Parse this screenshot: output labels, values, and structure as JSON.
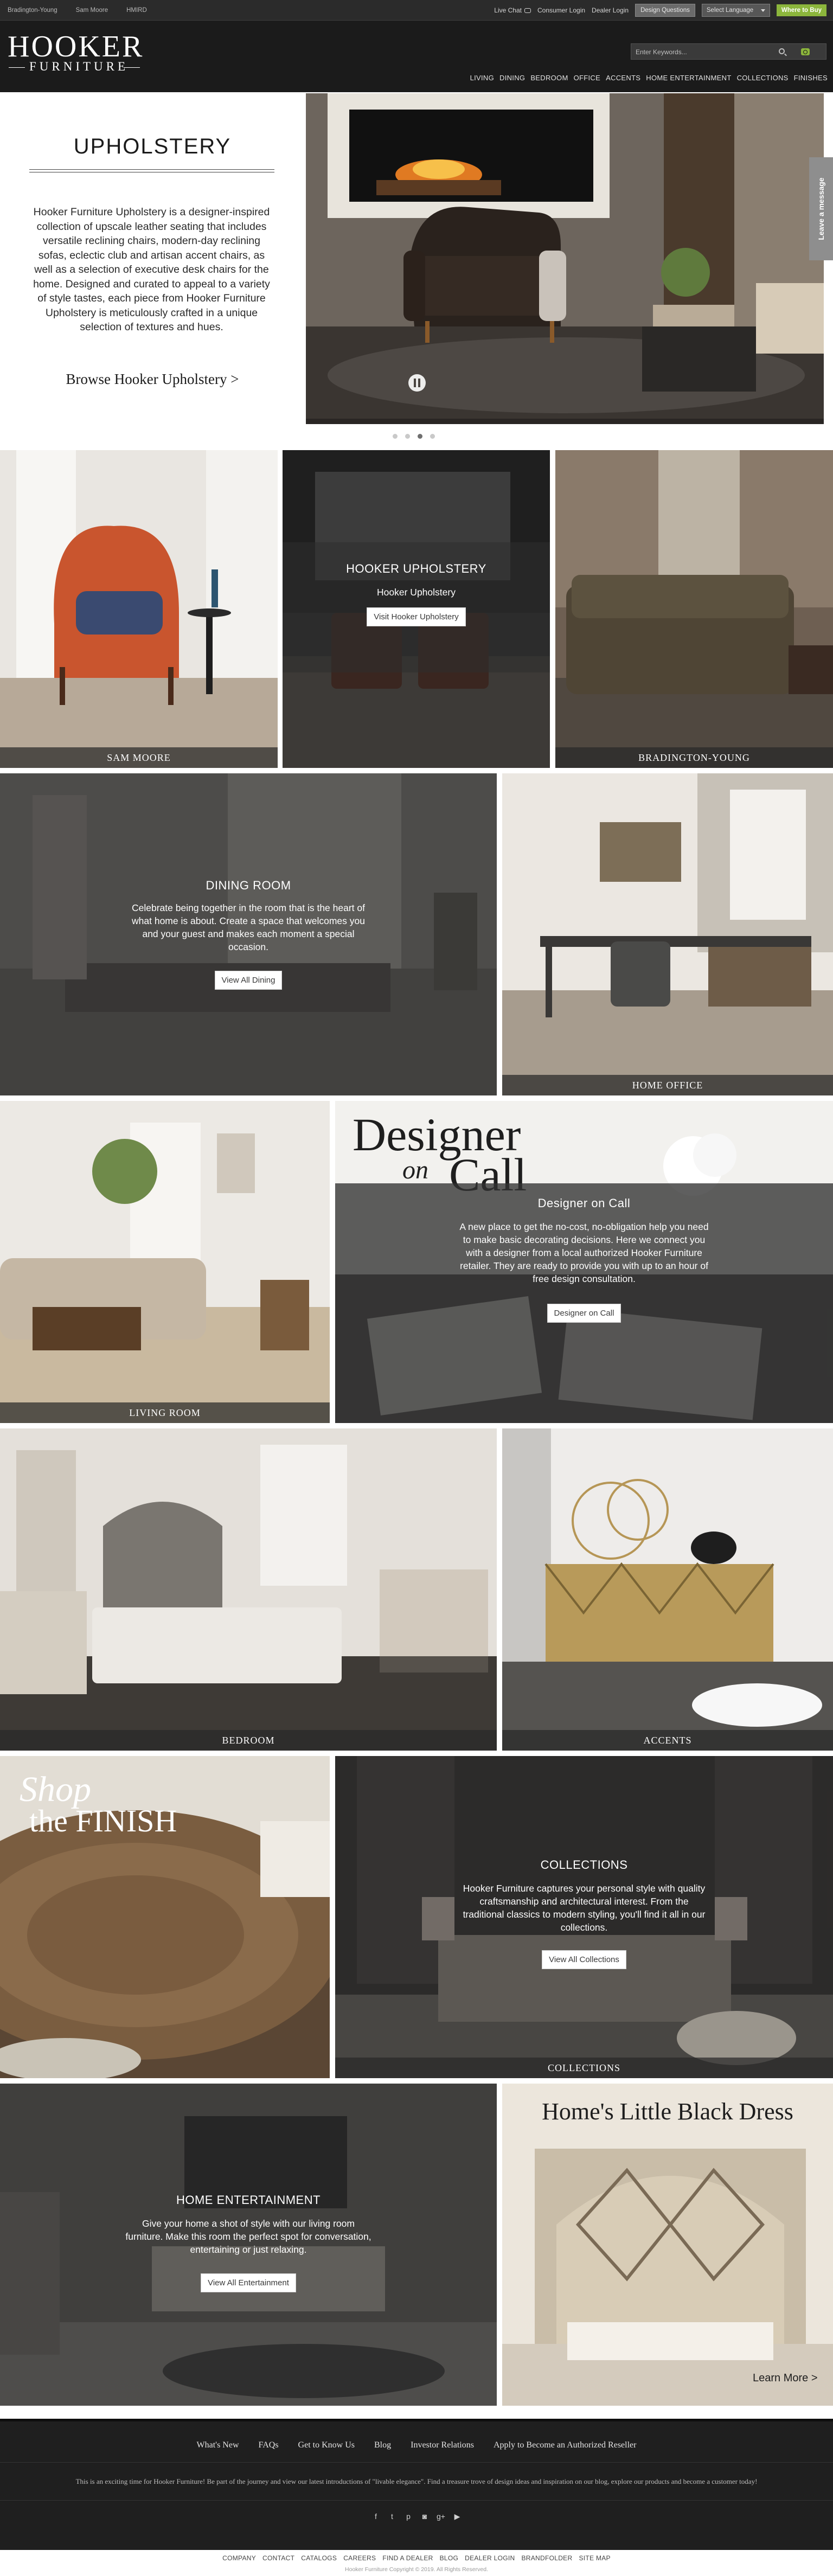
{
  "topbar": {
    "brands": [
      "Bradington-Young",
      "Sam Moore",
      "HMIRD"
    ],
    "live_chat": "Live Chat",
    "consumer_login": "Consumer Login",
    "dealer_login": "Dealer Login",
    "design_questions": "Design Questions",
    "language": "Select Language",
    "buy": "Where to Buy"
  },
  "header": {
    "logo_top": "HOOKER",
    "logo_bottom": "FURNITURE",
    "search_placeholder": "Enter Keywords...",
    "nav": [
      "Living",
      "Dining",
      "Bedroom",
      "Office",
      "Accents",
      "Home Entertainment",
      "Collections",
      "Finishes"
    ]
  },
  "upholstery": {
    "title": "UPHOLSTERY",
    "body": "Hooker Furniture Upholstery is a designer-inspired collection of upscale leather seating that includes versatile reclining chairs, modern-day reclining sofas, eclectic club and artisan accent chairs, as well as a selection of executive desk chairs for the home. Designed and curated to appeal to a variety of style tastes, each piece from Hooker Furniture Upholstery is meticulously crafted in a unique selection of textures and hues.",
    "link": "Browse Hooker Upholstery >",
    "slide_count": 4,
    "active_slide": 3,
    "leave_message": "Leave a message"
  },
  "tiles": {
    "sam_moore": "SAM MOORE",
    "hooker_uph": {
      "title": "HOOKER UPHOLSTERY",
      "sub": "Hooker Upholstery",
      "button": "Visit Hooker Upholstery"
    },
    "bradington": "BRADINGTON-YOUNG",
    "dining": {
      "title": "DINING ROOM",
      "desc": "Celebrate being together in the room that is the heart of what home is about. Create a space that welcomes you and your guest and makes each moment a special occasion.",
      "button": "View All Dining"
    },
    "home_office": "HOME OFFICE",
    "living": "LIVING ROOM",
    "designer": {
      "script1": "Designer",
      "script2": "on",
      "script3": "Call",
      "title": "Designer on Call",
      "desc": "A new place to get the no-cost, no-obligation help you need to make basic decorating decisions. Here we connect you with a designer from a local authorized Hooker Furniture retailer. They are ready to provide you with up to an hour of free design consultation.",
      "button": "Designer on Call"
    },
    "bedroom": "BEDROOM",
    "accents": "ACCENTS",
    "finish": {
      "line1": "Shop",
      "line2": "the FINISH"
    },
    "collections": {
      "title": "COLLECTIONS",
      "desc": "Hooker Furniture captures your personal style with quality craftsmanship and architectural interest. From the traditional classics to modern styling, you'll find it all in our collections.",
      "button": "View All Collections",
      "caption": "COLLECTIONS"
    },
    "entertainment": {
      "title": "HOME ENTERTAINMENT",
      "desc": "Give your home a shot of style with our living room furniture. Make this room the perfect spot for conversation, entertaining or just relaxing.",
      "button": "View All Entertainment"
    },
    "black_dress": {
      "title": "Home's Little Black Dress",
      "link": "Learn More >"
    }
  },
  "footer": {
    "nav": [
      "What's New",
      "FAQs",
      "Get to Know Us",
      "Blog",
      "Investor Relations",
      "Apply to Become an Authorized Reseller"
    ],
    "blurb": "This is an exciting time for Hooker Furniture! Be part of the journey and view our latest introductions of \"livable elegance\". Find a treasure trove of design ideas and inspiration on our blog, explore our products and become a customer today!",
    "social": [
      "facebook-icon",
      "twitter-icon",
      "pinterest-icon",
      "instagram-icon",
      "googleplus-icon",
      "youtube-icon"
    ],
    "subnav": [
      "COMPANY",
      "CONTACT",
      "CATALOGS",
      "CAREERS",
      "FIND A DEALER",
      "BLOG",
      "DEALER LOGIN",
      "BRANDFOLDER",
      "SITE MAP"
    ],
    "copyright": "Hooker Furniture Copyright © 2019. All Rights Reserved."
  },
  "colors": {
    "accent_green": "#8cb63c",
    "header_bg": "#1b1b1b",
    "topbar_bg": "#2b2b2b"
  }
}
